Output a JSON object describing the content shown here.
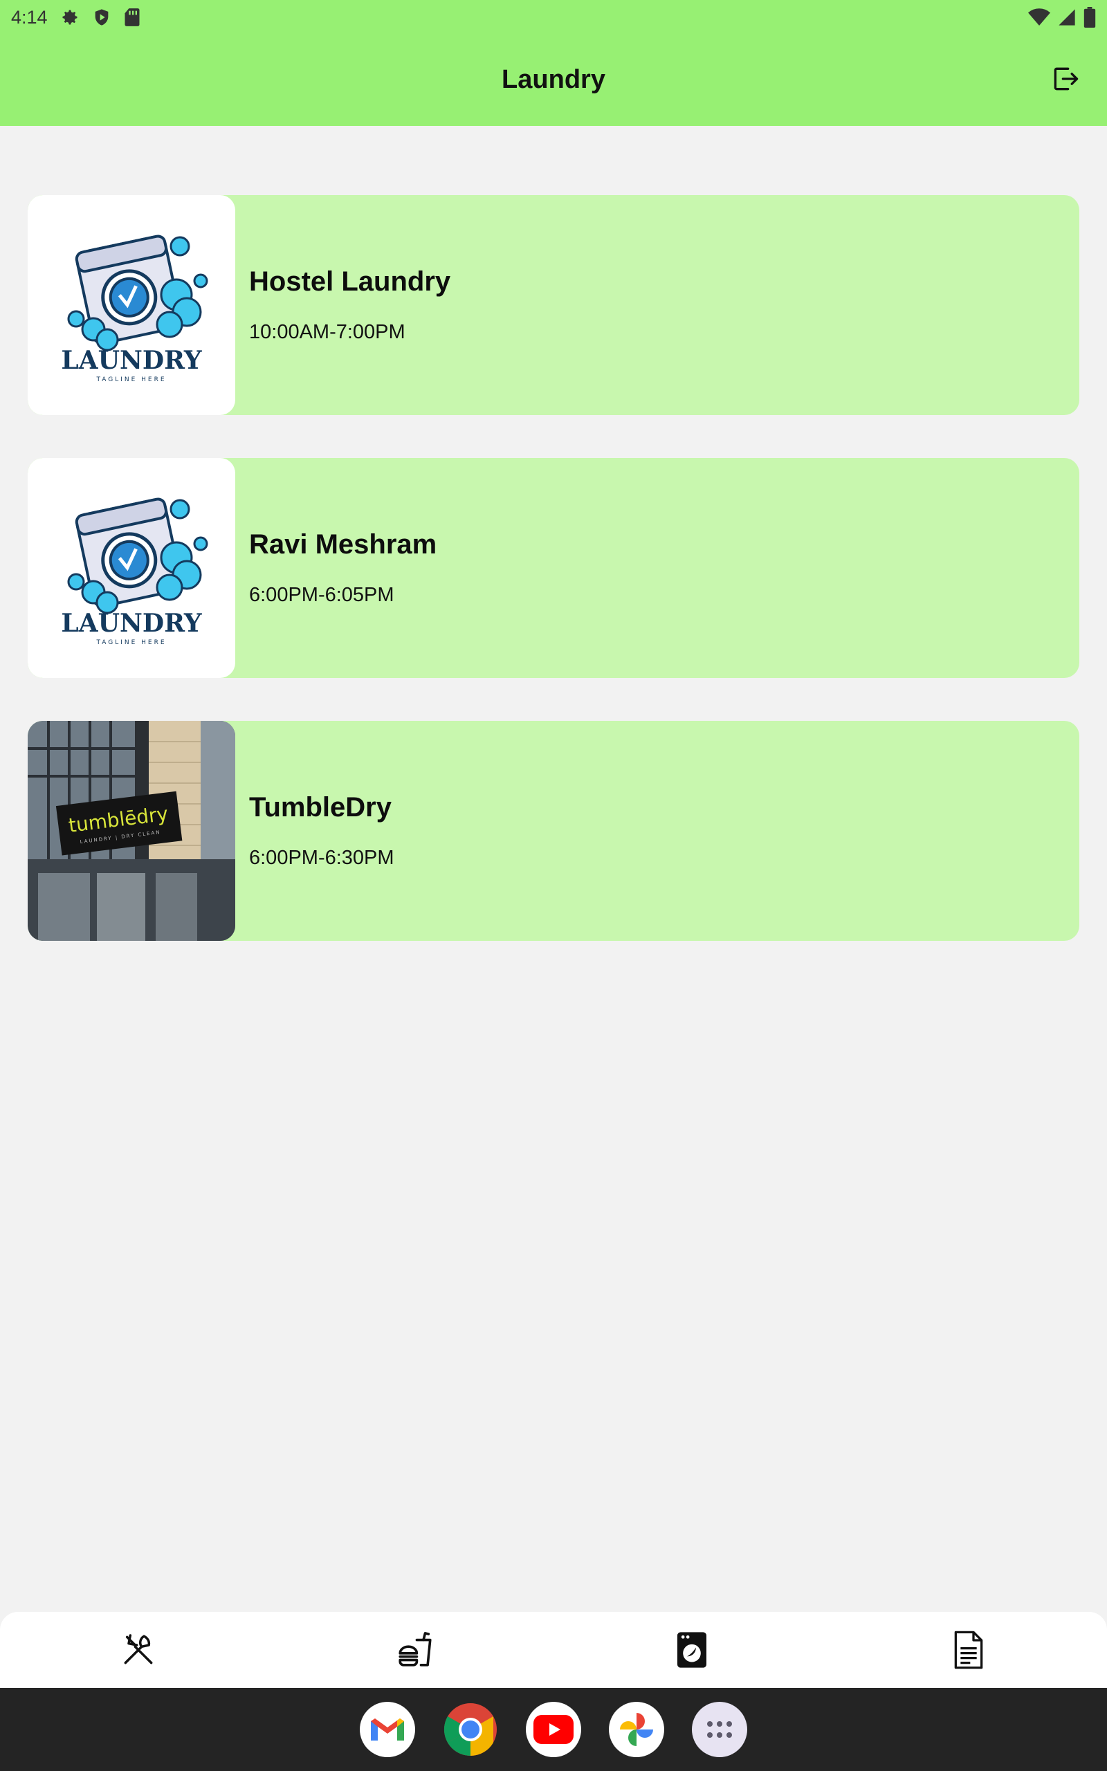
{
  "status_bar": {
    "time": "4:14",
    "left_icons": [
      "gear-icon",
      "shield-play-icon",
      "sd-card-icon"
    ],
    "right_icons": [
      "wifi-icon",
      "signal-icon",
      "battery-icon"
    ]
  },
  "app_bar": {
    "title": "Laundry",
    "action_icon": "logout-icon"
  },
  "shops": [
    {
      "name": "Hostel Laundry",
      "hours": "10:00AM-7:00PM",
      "image": "laundry-logo",
      "logo_text": "LAUNDRY",
      "logo_tagline": "TAGLINE HERE"
    },
    {
      "name": "Ravi Meshram",
      "hours": "6:00PM-6:05PM",
      "image": "laundry-logo",
      "logo_text": "LAUNDRY",
      "logo_tagline": "TAGLINE HERE"
    },
    {
      "name": "TumbleDry",
      "hours": "6:00PM-6:30PM",
      "image": "storefront-photo",
      "sign_text": "tumblēdry",
      "sign_subtext": "LAUNDRY | DRY CLEAN"
    }
  ],
  "bottom_nav": [
    {
      "icon": "cutlery-icon",
      "selected": false
    },
    {
      "icon": "fast-food-icon",
      "selected": false
    },
    {
      "icon": "washing-machine-icon",
      "selected": true
    },
    {
      "icon": "document-icon",
      "selected": false
    }
  ],
  "dock": [
    "gmail-icon",
    "chrome-icon",
    "youtube-icon",
    "photos-icon",
    "app-drawer-icon"
  ],
  "colors": {
    "app_bar": "#97f073",
    "card": "#c8f7ae",
    "background": "#f2f2f2",
    "dock": "#242424"
  }
}
